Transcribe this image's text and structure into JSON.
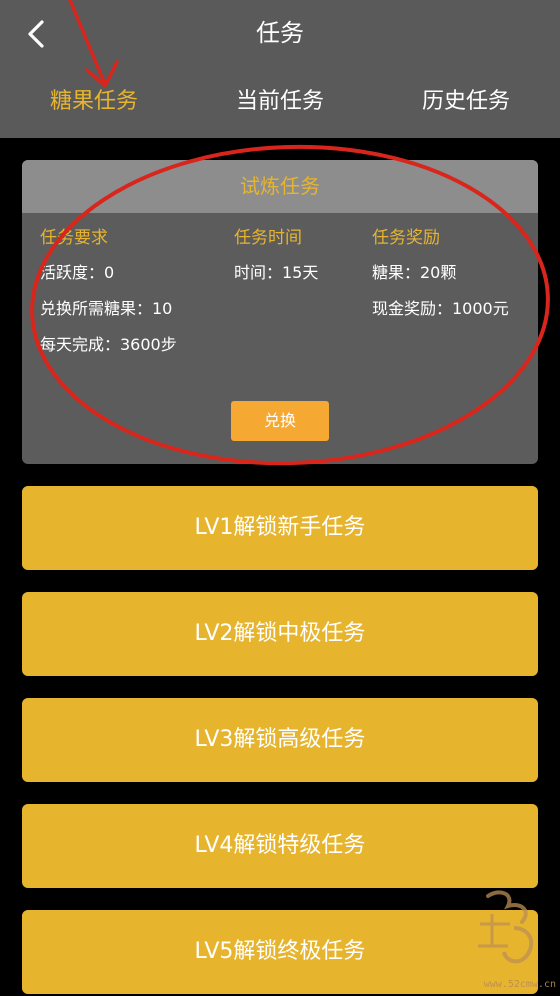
{
  "header": {
    "title": "任务",
    "tabs": [
      {
        "label": "糖果任务",
        "active": true
      },
      {
        "label": "当前任务",
        "active": false
      },
      {
        "label": "历史任务",
        "active": false
      }
    ]
  },
  "trial_card": {
    "title": "试炼任务",
    "columns": [
      {
        "heading": "任务要求",
        "rows": [
          "活跃度：0",
          "兑换所需糖果：10",
          "每天完成：3600步"
        ]
      },
      {
        "heading": "任务时间",
        "rows": [
          "时间：15天"
        ]
      },
      {
        "heading": "任务奖励",
        "rows": [
          "糖果：20颗",
          "现金奖励：1000元"
        ]
      }
    ],
    "exchange_label": "兑换"
  },
  "levels": [
    "LV1解锁新手任务",
    "LV2解锁中极任务",
    "LV3解锁高级任务",
    "LV4解锁特级任务",
    "LV5解锁终极任务"
  ],
  "watermark": {
    "site": "www.52cmw.cn"
  },
  "colors": {
    "header_bg": "#5a5a5a",
    "accent": "#e7b430",
    "button_orange": "#f5a832",
    "annotation_red": "#d9261c"
  }
}
